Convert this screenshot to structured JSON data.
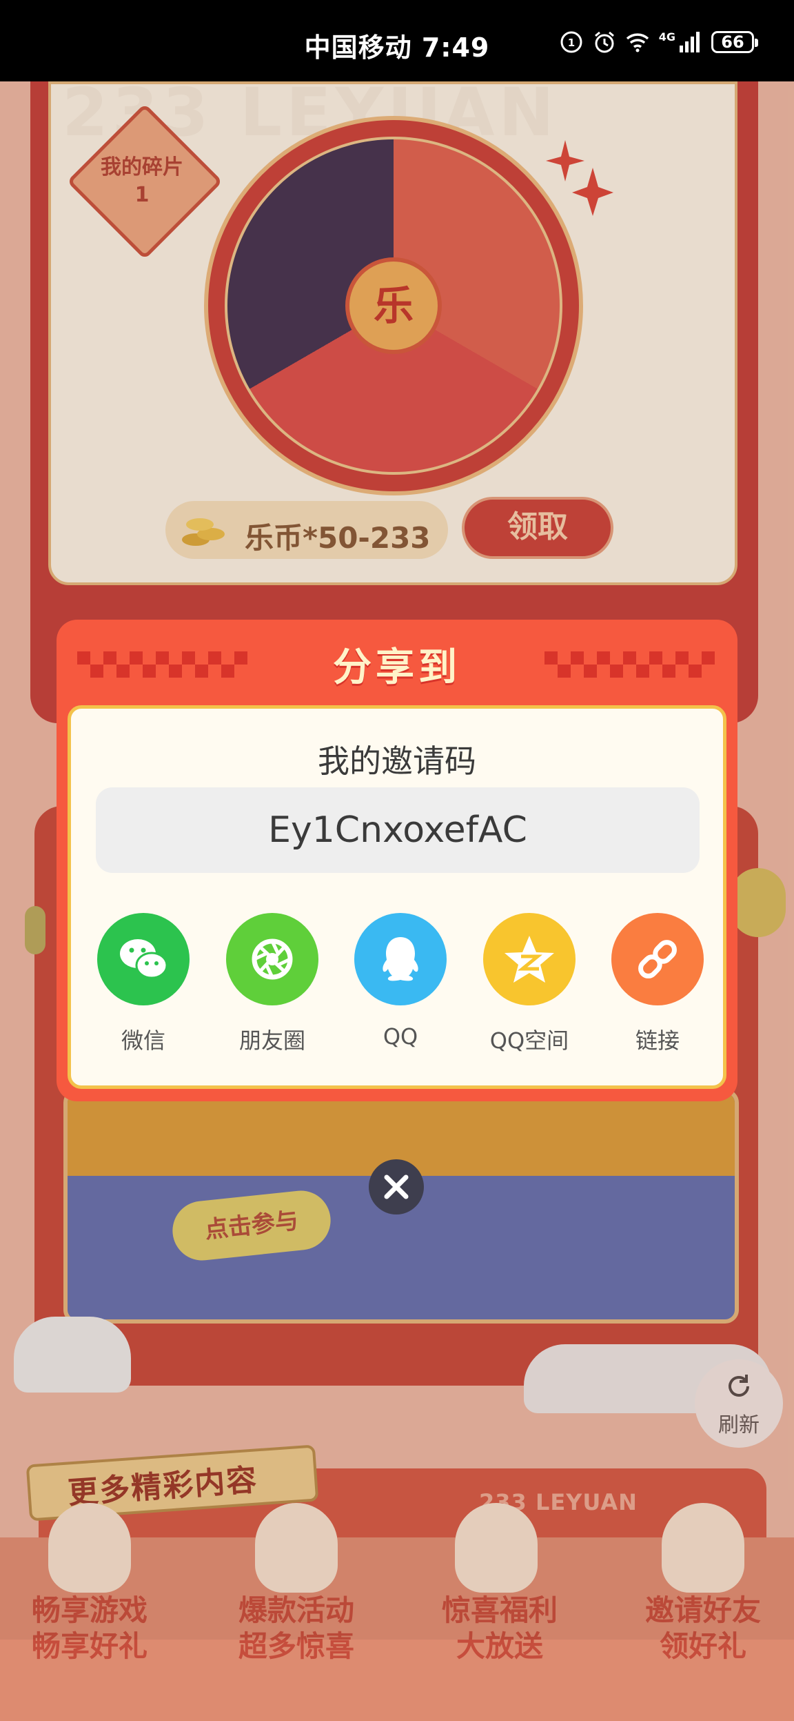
{
  "status_bar": {
    "carrier_time": "中国移动 7:49",
    "network": "4G",
    "battery": "66"
  },
  "background": {
    "watermark": "233 LEYUAN",
    "fragment_badge": {
      "label": "我的碎片",
      "count": "1"
    },
    "wheel_center": "乐",
    "coin_text": "乐币*50-233",
    "claim_button": "领取",
    "join_button": "点击参与",
    "refresh_label": "刷新",
    "more_title": "更多精彩内容",
    "more_brand": "233 LEYUAN",
    "features": [
      {
        "line1": "畅享游戏",
        "line2": "畅享好礼"
      },
      {
        "line1": "爆款活动",
        "line2": "超多惊喜"
      },
      {
        "line1": "惊喜福利",
        "line2": "大放送"
      },
      {
        "line1": "邀请好友",
        "line2": "领好礼"
      }
    ]
  },
  "share_dialog": {
    "title": "分享到",
    "invite_label": "我的邀请码",
    "invite_code": "Ey1CnxoxefAC",
    "targets": [
      {
        "label": "微信",
        "icon": "wechat-icon",
        "color": "#2cc34e"
      },
      {
        "label": "朋友圈",
        "icon": "moments-icon",
        "color": "#5fcf3a"
      },
      {
        "label": "QQ",
        "icon": "qq-icon",
        "color": "#3ab9f2"
      },
      {
        "label": "QQ空间",
        "icon": "qzone-icon",
        "color": "#f8c52e"
      },
      {
        "label": "链接",
        "icon": "link-icon",
        "color": "#fa7d40"
      }
    ]
  },
  "colors": {
    "dialog": "#f6593f",
    "dialog_body": "#fffbf1",
    "accent_gold": "#f3c24b"
  }
}
